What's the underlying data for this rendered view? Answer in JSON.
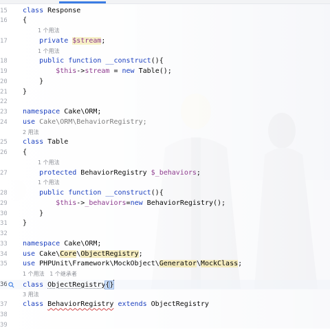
{
  "editor": {
    "lines": [
      {
        "n": "15",
        "segs": [
          {
            "t": "class ",
            "c": "kw"
          },
          {
            "t": "Response",
            "c": "cls"
          }
        ]
      },
      {
        "n": "16",
        "segs": [
          {
            "t": "{",
            "c": "cls"
          }
        ]
      },
      {
        "n": "",
        "hint": "1 个用法",
        "indent": 22
      },
      {
        "n": "17",
        "segs": [
          {
            "t": "    private ",
            "c": "kw"
          },
          {
            "t": "$stream",
            "c": "var hl-name"
          },
          {
            "t": ";",
            "c": "cls"
          }
        ]
      },
      {
        "n": "",
        "hint": "1 个用法",
        "indent": 22
      },
      {
        "n": "18",
        "segs": [
          {
            "t": "    public function ",
            "c": "kw"
          },
          {
            "t": "__construct",
            "c": "kw"
          },
          {
            "t": "(){",
            "c": "cls"
          }
        ]
      },
      {
        "n": "19",
        "segs": [
          {
            "t": "        ",
            "c": "cls"
          },
          {
            "t": "$this",
            "c": "var"
          },
          {
            "t": "->",
            "c": "cls"
          },
          {
            "t": "stream",
            "c": "field"
          },
          {
            "t": " = ",
            "c": "cls"
          },
          {
            "t": "new ",
            "c": "kw"
          },
          {
            "t": "Table();",
            "c": "cls"
          }
        ]
      },
      {
        "n": "20",
        "segs": [
          {
            "t": "    }",
            "c": "cls"
          }
        ]
      },
      {
        "n": "21",
        "segs": [
          {
            "t": "}",
            "c": "cls"
          }
        ]
      },
      {
        "n": "22",
        "segs": []
      },
      {
        "n": "23",
        "segs": [
          {
            "t": "namespace ",
            "c": "kw"
          },
          {
            "t": "Cake\\ORM;",
            "c": "cls"
          }
        ]
      },
      {
        "n": "24",
        "segs": [
          {
            "t": "use ",
            "c": "kw"
          },
          {
            "t": "Cake\\ORM\\BehaviorRegistry;",
            "c": "greyed"
          }
        ]
      },
      {
        "n": "",
        "hint": "2 用法",
        "indent": 0
      },
      {
        "n": "25",
        "segs": [
          {
            "t": "class ",
            "c": "kw"
          },
          {
            "t": "Table",
            "c": "cls"
          }
        ]
      },
      {
        "n": "26",
        "segs": [
          {
            "t": "{",
            "c": "cls"
          }
        ]
      },
      {
        "n": "",
        "hint": "1 个用法",
        "indent": 22
      },
      {
        "n": "27",
        "segs": [
          {
            "t": "    protected ",
            "c": "kw"
          },
          {
            "t": "BehaviorRegistry ",
            "c": "cls"
          },
          {
            "t": "$_behaviors",
            "c": "var"
          },
          {
            "t": ";",
            "c": "cls"
          }
        ]
      },
      {
        "n": "",
        "hint": "1 个用法",
        "indent": 22
      },
      {
        "n": "28",
        "segs": [
          {
            "t": "    public function ",
            "c": "kw"
          },
          {
            "t": "__construct",
            "c": "kw"
          },
          {
            "t": "(){",
            "c": "cls"
          }
        ]
      },
      {
        "n": "29",
        "segs": [
          {
            "t": "        ",
            "c": "cls"
          },
          {
            "t": "$this",
            "c": "var"
          },
          {
            "t": "->",
            "c": "cls"
          },
          {
            "t": "_behaviors",
            "c": "field"
          },
          {
            "t": "=",
            "c": "cls"
          },
          {
            "t": "new ",
            "c": "kw"
          },
          {
            "t": "BehaviorRegistry();",
            "c": "cls"
          }
        ]
      },
      {
        "n": "30",
        "segs": [
          {
            "t": "    }",
            "c": "cls"
          }
        ]
      },
      {
        "n": "31",
        "segs": [
          {
            "t": "}",
            "c": "cls"
          }
        ]
      },
      {
        "n": "32",
        "segs": []
      },
      {
        "n": "33",
        "segs": [
          {
            "t": "namespace ",
            "c": "kw"
          },
          {
            "t": "Cake\\ORM;",
            "c": "cls"
          }
        ]
      },
      {
        "n": "34",
        "segs": [
          {
            "t": "use ",
            "c": "kw"
          },
          {
            "t": "Cake\\",
            "c": "cls"
          },
          {
            "t": "Core",
            "c": "cls hl-use"
          },
          {
            "t": "\\",
            "c": "cls"
          },
          {
            "t": "ObjectRegistry",
            "c": "cls hl-use"
          },
          {
            "t": ";",
            "c": "cls"
          }
        ]
      },
      {
        "n": "35",
        "segs": [
          {
            "t": "use ",
            "c": "kw"
          },
          {
            "t": "PHPUnit\\Framework\\MockObject\\",
            "c": "cls"
          },
          {
            "t": "Generator",
            "c": "cls hl-use"
          },
          {
            "t": "\\",
            "c": "cls"
          },
          {
            "t": "MockClass",
            "c": "cls hl-use"
          },
          {
            "t": ";",
            "c": "cls"
          }
        ]
      },
      {
        "n": "",
        "hint": "1 个用法   1 个继承者",
        "indent": 0
      },
      {
        "n": "36",
        "active": true,
        "icon": true,
        "segs": [
          {
            "t": "class ",
            "c": "kw"
          },
          {
            "t": "ObjectRegistry",
            "c": "cls dotted"
          },
          {
            "t": "{",
            "c": "cls brace-hl"
          },
          {
            "t": "}",
            "c": "cls brace-hl"
          },
          {
            "t": "",
            "c": "caret"
          }
        ]
      },
      {
        "n": "",
        "hint": "3 用法",
        "indent": 0
      },
      {
        "n": "37",
        "segs": [
          {
            "t": "class ",
            "c": "kw"
          },
          {
            "t": "BehaviorRegistry",
            "c": "cls squiggle"
          },
          {
            "t": " extends ",
            "c": "kw"
          },
          {
            "t": "ObjectRegistry",
            "c": "cls"
          }
        ]
      },
      {
        "n": "38",
        "segs": []
      },
      {
        "n": "39",
        "segs": []
      }
    ]
  }
}
